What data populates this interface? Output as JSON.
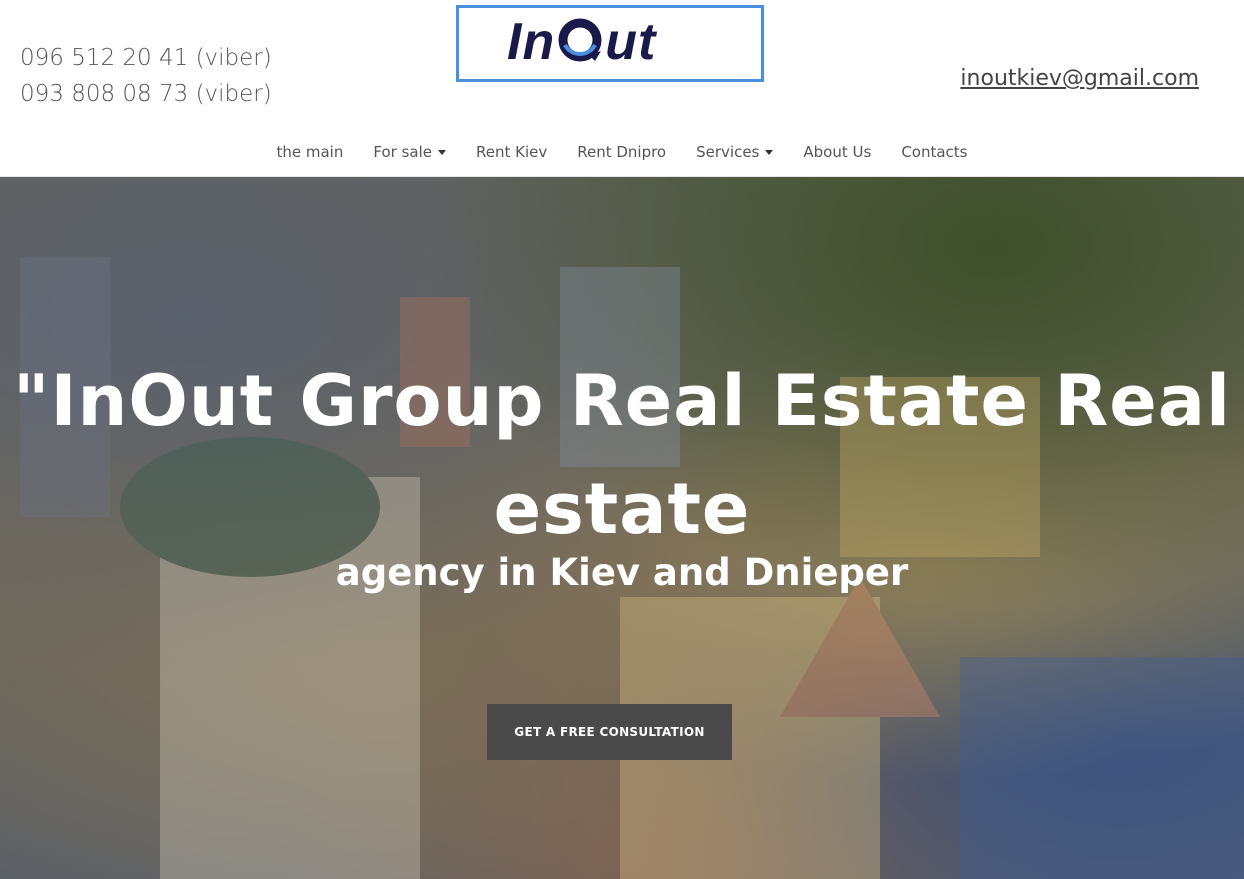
{
  "header": {
    "phones": [
      "096 512 20 41 (viber)",
      "093 808 08 73 (viber)"
    ],
    "logo_text_left": "In",
    "logo_text_right": "ut",
    "email": "inoutkiev@gmail.com"
  },
  "nav": {
    "items": [
      {
        "label": "the main",
        "has_caret": false
      },
      {
        "label": "For sale",
        "has_caret": true
      },
      {
        "label": "Rent Kiev",
        "has_caret": false
      },
      {
        "label": "Rent Dnipro",
        "has_caret": false
      },
      {
        "label": "Services",
        "has_caret": true
      },
      {
        "label": "About Us",
        "has_caret": false
      },
      {
        "label": "Contacts",
        "has_caret": false
      }
    ]
  },
  "hero": {
    "title": "\"InOut Group Real Estate Real estate",
    "subtitle": "agency in Kiev and Dnieper",
    "cta_label": "GET A FREE CONSULTATION"
  },
  "colors": {
    "logo_border": "#4a90e2",
    "logo_text": "#1a1a4a",
    "cta_bg": "#4a4a4a"
  }
}
